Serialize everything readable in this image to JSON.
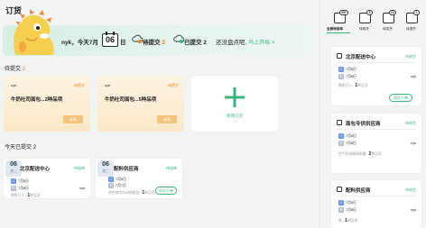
{
  "header": {
    "title": "订货"
  },
  "banner": {
    "user": "nyk，今天7月",
    "day": "06",
    "day_suffix": "日",
    "pending_count": "2",
    "pending_label": "待提交",
    "submitted_count": "2",
    "submitted_label": "已提交",
    "stocktake_text": "还没盘点呢,",
    "start_link": "马上开始 >"
  },
  "pending": {
    "section_title": "待提交",
    "section_count": "2",
    "cards": [
      {
        "user": "nyk",
        "status": "未提交",
        "title_prefix": "牛奶吐司面包...",
        "count": "2",
        "title_suffix": "种品项",
        "button": "查看"
      },
      {
        "user": "nyk",
        "status": "未提交",
        "title_prefix": "牛奶吐司面包...",
        "count": "5",
        "title_suffix": "种品项",
        "button": "查看"
      }
    ],
    "new_order": {
      "icon": "plus-icon",
      "label": "新增订货"
    }
  },
  "submitted_today": {
    "section_title": "今天已提交",
    "section_count": "2",
    "cards": [
      {
        "day": "06",
        "weekday": "周二",
        "name": "北京配送中心",
        "status": "待接单",
        "date1": "7月6日",
        "date2": "7月8日",
        "user": "nyk",
        "summary_prefix": "鲍鱼仔入...",
        "count": "1",
        "summary_suffix": "种品项",
        "button": ""
      },
      {
        "day": "06",
        "weekday": "周二",
        "name": "配料供应商",
        "status": "待接单",
        "date1": "7月6日",
        "date2": "7月7日",
        "user": "nyk",
        "summary_prefix": "供应商专供动物面包...",
        "count": "1",
        "summary_suffix": "种品项",
        "button": "再次下单"
      }
    ]
  },
  "right_tabs": [
    {
      "badge": "99+",
      "label": "全部待接单",
      "active": true
    },
    {
      "badge": "5",
      "label": "待收货",
      "active": false
    },
    {
      "badge": "24",
      "label": "待发货",
      "active": false
    },
    {
      "badge": "2",
      "label": "待退货",
      "active": false
    }
  ],
  "right_orders": [
    {
      "name": "北京配送中心",
      "status": "待收货",
      "date1": "7月6日",
      "date2": "7月8日",
      "user": "nyk",
      "summary_prefix": "鲍鱼仔入...",
      "count": "1",
      "summary_suffix": "种品项",
      "button": "再次下单"
    },
    {
      "name": "面包专供供应商",
      "status": "待收货",
      "date1": "7月6日",
      "date2": "7月8日",
      "user": "nyk",
      "summary_prefix": "空气的油桶采购橄...",
      "count": "2",
      "summary_suffix": "种品项",
      "button": ""
    },
    {
      "name": "配料供应商",
      "status": "待收货",
      "date1": "7月6日",
      "date2": "7月8日",
      "user": "nyk",
      "summary_prefix": "鲍...",
      "count": "1",
      "summary_suffix": "种品项",
      "button": ""
    }
  ],
  "colors": {
    "accent": "#3ab27a",
    "warning": "#f0801c",
    "pending_card": "#fbe8c8"
  }
}
